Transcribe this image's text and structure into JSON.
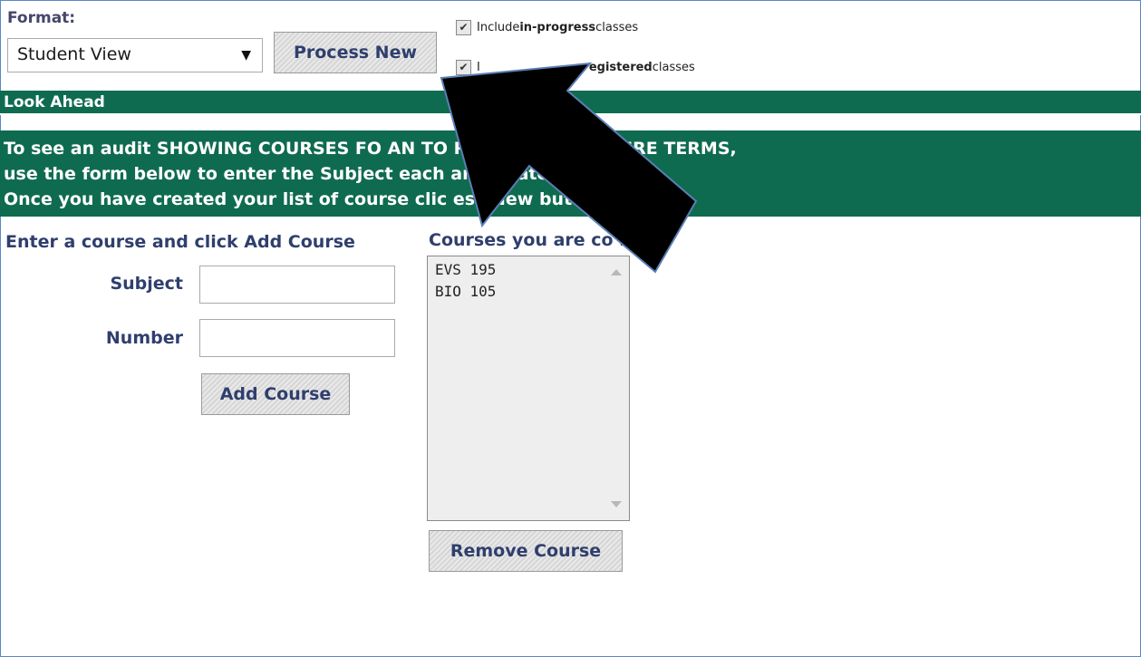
{
  "format": {
    "label": "Format:",
    "selected": "Student View"
  },
  "buttons": {
    "process_new": "Process New",
    "add_course": "Add Course",
    "remove_course": "Remove Course"
  },
  "options": {
    "in_progress": {
      "prefix": "Include ",
      "bold": "in-progress",
      "suffix": " classes",
      "checked": true
    },
    "registered": {
      "prefix": "I",
      "bold": "egistered",
      "suffix": " classes",
      "checked": true
    }
  },
  "look_ahead": {
    "title": "Look Ahead",
    "lines": [
      "To see an audit SHOWING COURSES FO                   AN TO REGISTER IN FUTURE TERMS,",
      "use the form below to enter the Subject                each anticipated course.",
      "Once you have created your list of course    clic                ess New button."
    ]
  },
  "enter_course": {
    "label": "Enter a course and click Add Course",
    "subject_label": "Subject",
    "number_label": "Number",
    "subject_value": "",
    "number_value": ""
  },
  "considering": {
    "label": "Courses you are co       ring",
    "courses": [
      "EVS 195",
      "BIO 105"
    ]
  },
  "colors": {
    "band": "#0f6b4f",
    "label_text": "#2f3f6d",
    "arrow": "#000000"
  }
}
